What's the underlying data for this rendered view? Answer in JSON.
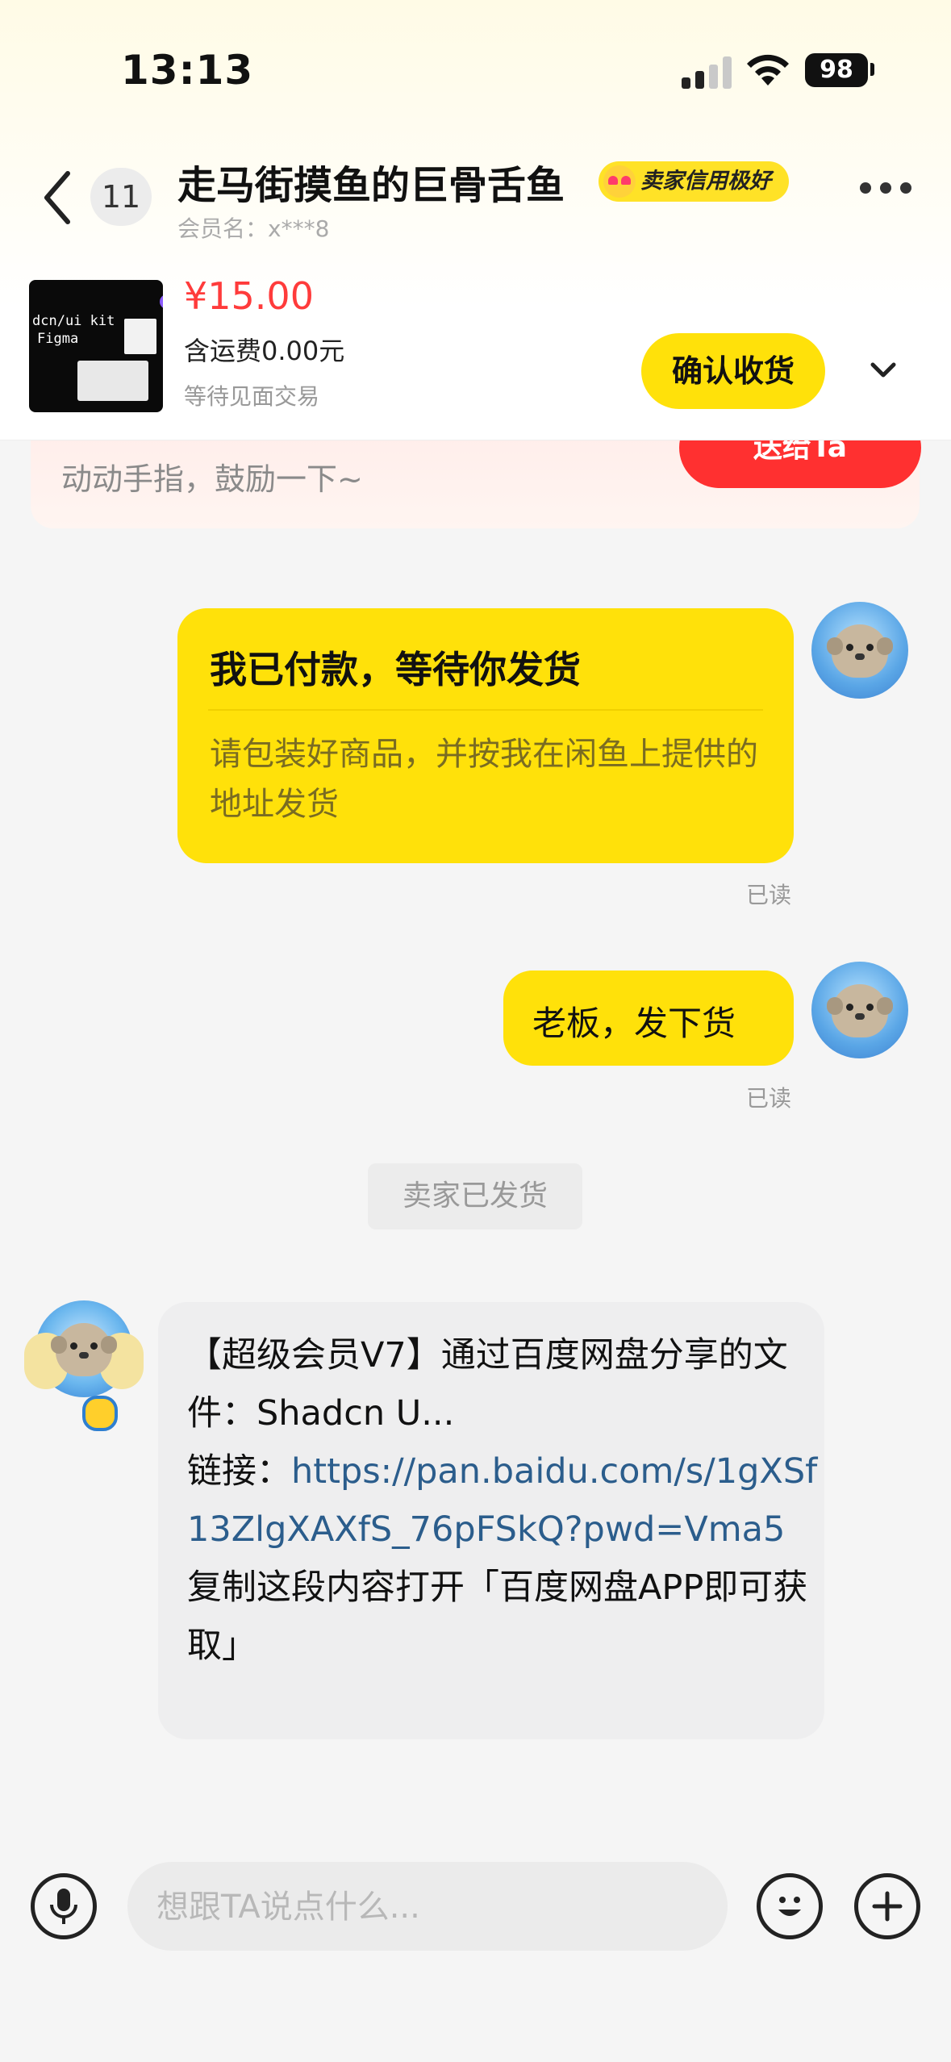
{
  "status_bar": {
    "time": "13:13",
    "battery": "98"
  },
  "header": {
    "unread_count": "11",
    "seller_name": "走马街摸鱼的巨骨舌鱼",
    "credit_badge": "卖家信用极好",
    "member_line": "会员名：x***8"
  },
  "order": {
    "thumb_line1": "dcn/ui kit",
    "thumb_line2": "Figma",
    "price": "¥15.00",
    "shipping": "含运费0.00元",
    "status": "等待见面交易",
    "confirm_label": "确认收货"
  },
  "banner": {
    "text": "动动手指，鼓励一下~",
    "button_label": "送给Ta"
  },
  "messages": {
    "order_card": {
      "title": "我已付款，等待你发货",
      "desc": "请包装好商品，并按我在闲鱼上提供的地址发货",
      "read": "已读"
    },
    "text1": {
      "text": "老板，发下货",
      "read": "已读"
    },
    "system": "卖家已发货",
    "share": {
      "line1": "【超级会员V7】通过百度网盘分享的文件：Shadcn U...",
      "link_prefix": "链接：",
      "link": "https://pan.baidu.com/s/1gXSf13ZlgXAXfS_76pFSkQ?pwd=Vma5",
      "line3": "复制这段内容打开「百度网盘APP即可获取」"
    }
  },
  "input": {
    "placeholder": "想跟TA说点什么..."
  }
}
